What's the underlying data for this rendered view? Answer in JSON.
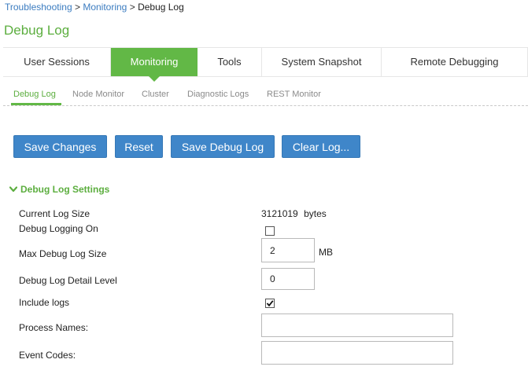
{
  "breadcrumb": {
    "items": [
      "Troubleshooting",
      "Monitoring",
      "Debug Log"
    ],
    "separator": ">"
  },
  "page_title": "Debug Log",
  "main_tabs": [
    {
      "label": "User Sessions",
      "active": false
    },
    {
      "label": "Monitoring",
      "active": true
    },
    {
      "label": "Tools",
      "active": false
    },
    {
      "label": "System Snapshot",
      "active": false
    },
    {
      "label": "Remote Debugging",
      "active": false
    }
  ],
  "sub_tabs": [
    {
      "label": "Debug Log",
      "active": true
    },
    {
      "label": "Node Monitor",
      "active": false
    },
    {
      "label": "Cluster",
      "active": false
    },
    {
      "label": "Diagnostic Logs",
      "active": false
    },
    {
      "label": "REST Monitor",
      "active": false
    }
  ],
  "buttons": {
    "save_changes": "Save Changes",
    "reset": "Reset",
    "save_debug_log": "Save Debug Log",
    "clear_log": "Clear Log..."
  },
  "section": {
    "title": "Debug Log Settings",
    "icon": "chevron-down-icon",
    "fields": {
      "current_log_size": {
        "label": "Current Log Size",
        "value": "3121019",
        "unit": "bytes"
      },
      "debug_logging_on": {
        "label": "Debug Logging On",
        "checked": false
      },
      "max_debug_log_size": {
        "label": "Max Debug Log Size",
        "value": "2",
        "unit": "MB"
      },
      "detail_level": {
        "label": "Debug Log Detail Level",
        "value": "0"
      },
      "include_logs": {
        "label": "Include logs",
        "checked": true
      },
      "process_names": {
        "label": "Process Names:",
        "value": ""
      },
      "event_codes": {
        "label": "Event Codes:",
        "value": ""
      }
    }
  },
  "colors": {
    "accent_green": "#62b846",
    "button_blue": "#3f86c9",
    "link_blue": "#3b7cc0"
  }
}
